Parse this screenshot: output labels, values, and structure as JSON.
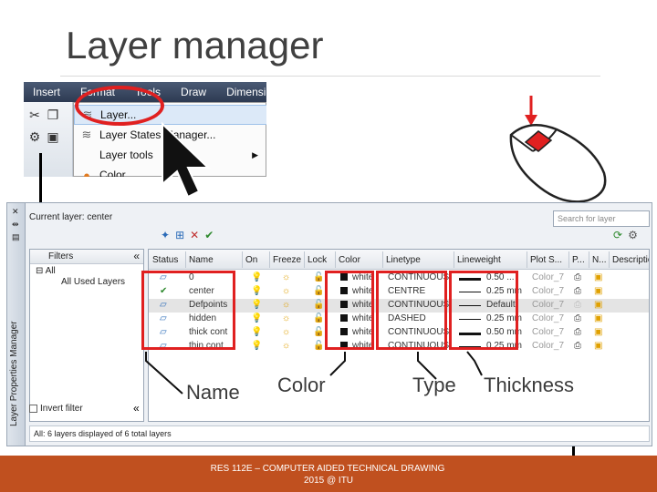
{
  "slide": {
    "title": "Layer manager"
  },
  "menu": {
    "bar": [
      "Insert",
      "Format",
      "Tools",
      "Draw",
      "Dimensi"
    ],
    "items": [
      {
        "label": "Layer..."
      },
      {
        "label": "Layer States Manager..."
      },
      {
        "label": "Layer tools"
      },
      {
        "label": "Color"
      }
    ]
  },
  "lpm": {
    "title": "Layer Properties Manager",
    "current_layer": "Current layer: center",
    "search_placeholder": "Search for layer",
    "filters_header": "Filters",
    "tree": [
      "All",
      "All Used Layers"
    ],
    "invert_filter": "Invert filter",
    "status": "All: 6 layers displayed of 6 total layers",
    "columns": [
      "Status",
      "Name",
      "On",
      "Freeze",
      "Lock",
      "Color",
      "Linetype",
      "Lineweight",
      "Plot S...",
      "P...",
      "N...",
      "Descriptio"
    ],
    "rows": [
      {
        "name": "0",
        "color": "white",
        "linetype": "CONTINUOUS",
        "lineweight": "0.50 ...",
        "plot_style": "Color_7"
      },
      {
        "name": "center",
        "color": "white",
        "linetype": "CENTRE",
        "lineweight": "0.25 mm",
        "plot_style": "Color_7"
      },
      {
        "name": "Defpoints",
        "color": "white",
        "linetype": "CONTINUOUS",
        "lineweight": "Default",
        "plot_style": "Color_7"
      },
      {
        "name": "hidden",
        "color": "white",
        "linetype": "DASHED",
        "lineweight": "0.25 mm",
        "plot_style": "Color_7"
      },
      {
        "name": "thick cont",
        "color": "white",
        "linetype": "CONTINUOUS",
        "lineweight": "0.50 mm",
        "plot_style": "Color_7"
      },
      {
        "name": "thin cont",
        "color": "white",
        "linetype": "CONTINUOUS",
        "lineweight": "0.25 mm",
        "plot_style": "Color_7"
      }
    ]
  },
  "annotations": {
    "name": "Name",
    "color": "Color",
    "type": "Type",
    "thickness": "Thickness"
  },
  "footer": {
    "line1": "RES 112E – COMPUTER AIDED TECHNICAL DRAWING",
    "line2": "2015 @ ITU"
  },
  "colors": {
    "accent_red": "#e02020",
    "footer_bg": "#c0501f"
  }
}
